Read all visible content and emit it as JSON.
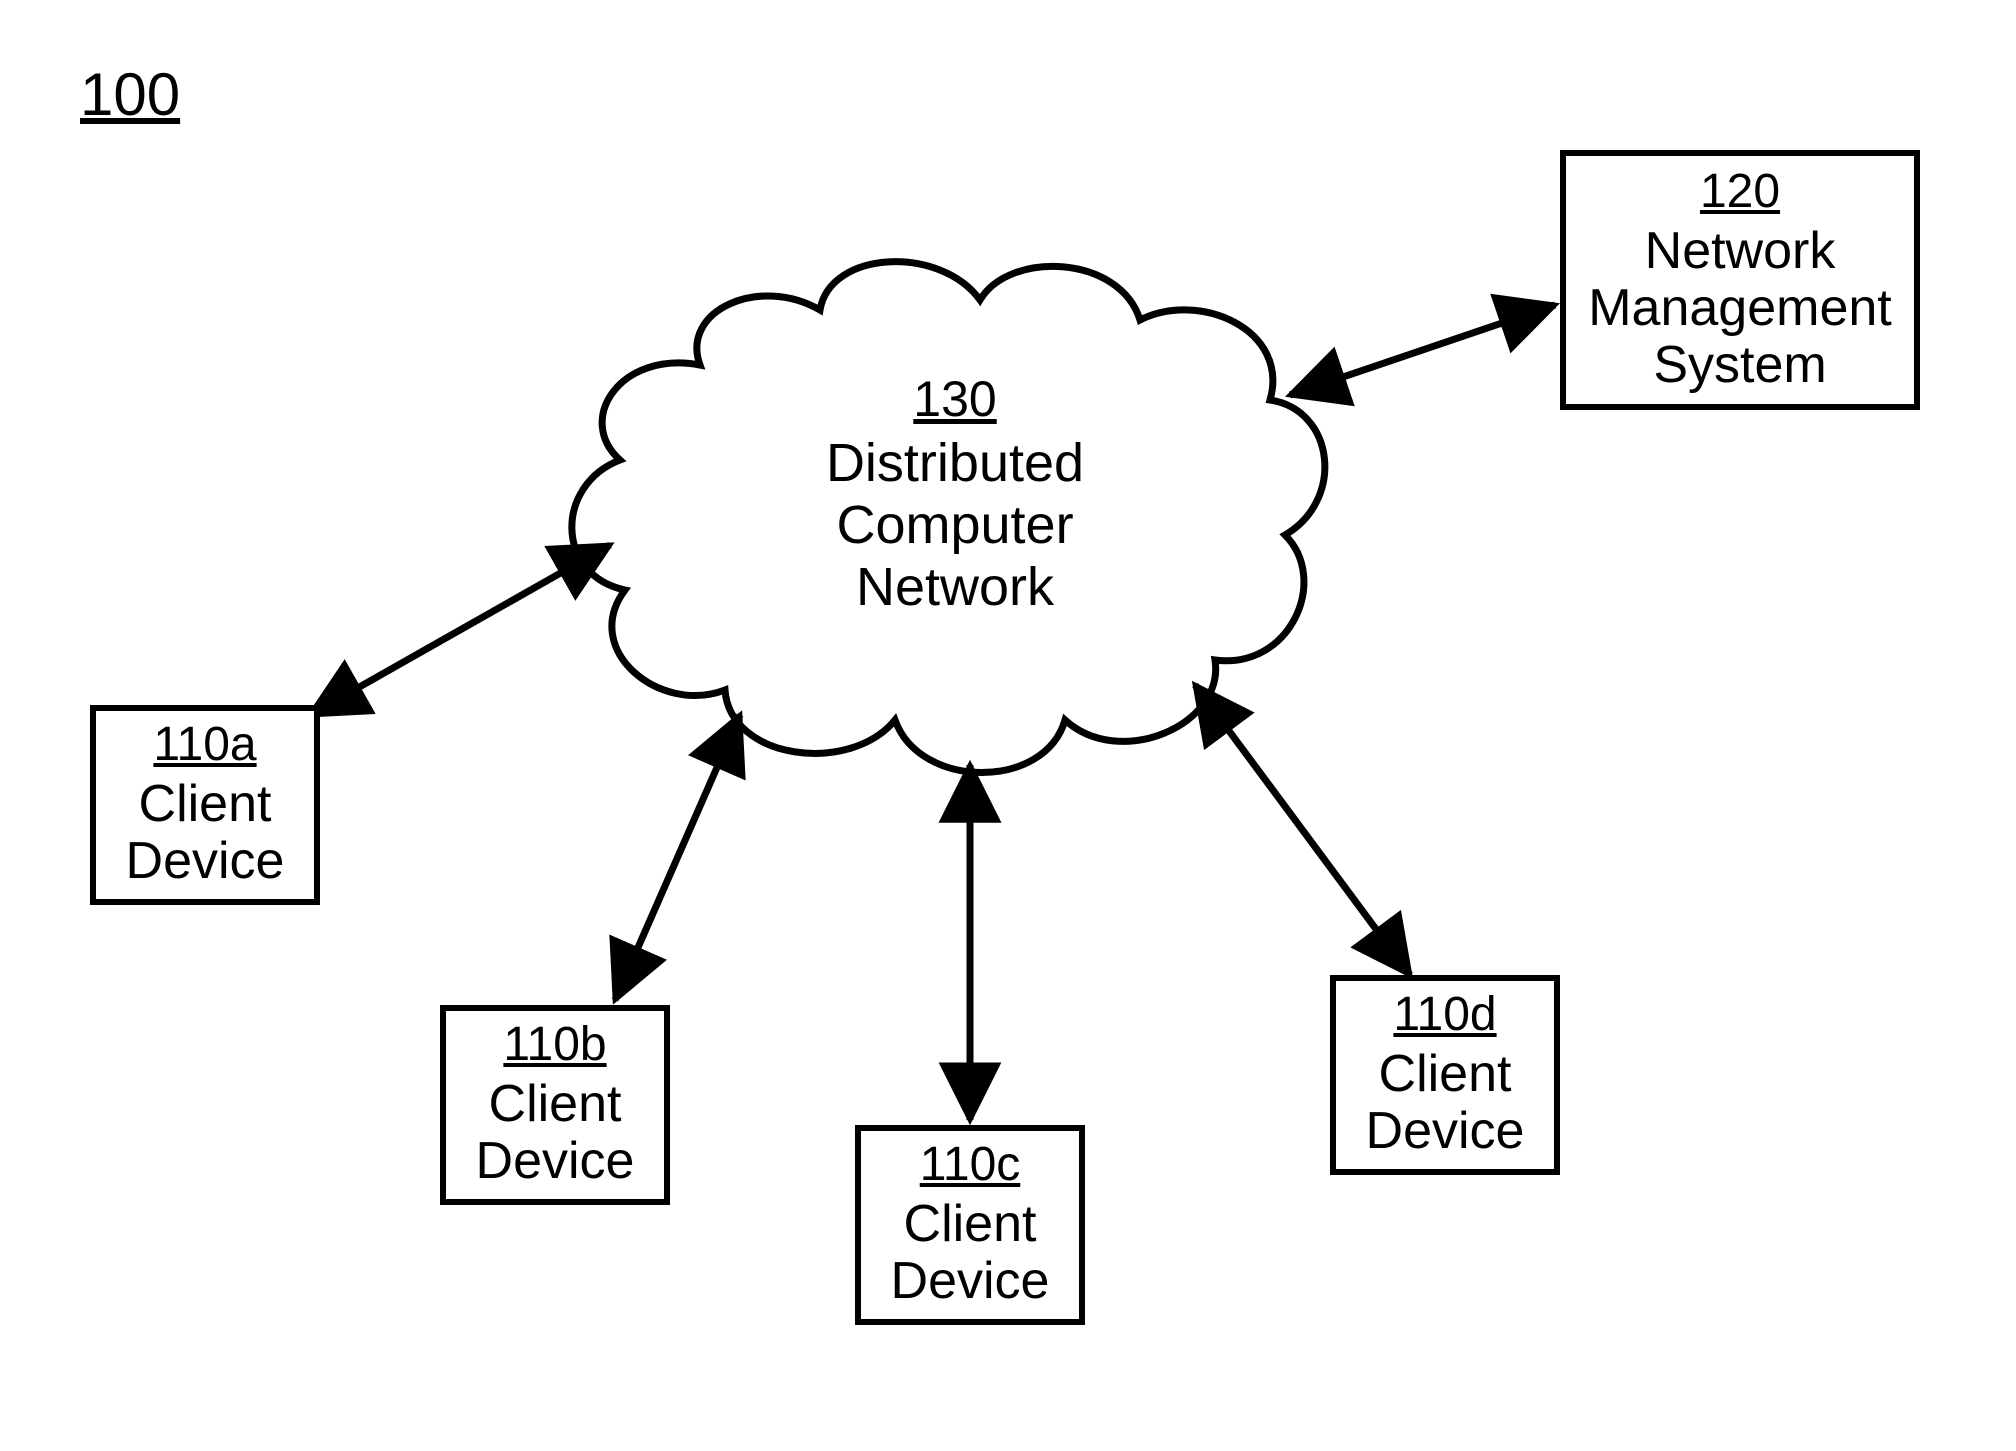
{
  "figure_ref": "100",
  "cloud": {
    "ref": "130",
    "line1": "Distributed",
    "line2": "Computer",
    "line3": "Network"
  },
  "nms": {
    "ref": "120",
    "line1": "Network",
    "line2": "Management",
    "line3": "System"
  },
  "client_a": {
    "ref": "110a",
    "line1": "Client",
    "line2": "Device"
  },
  "client_b": {
    "ref": "110b",
    "line1": "Client",
    "line2": "Device"
  },
  "client_c": {
    "ref": "110c",
    "line1": "Client",
    "line2": "Device"
  },
  "client_d": {
    "ref": "110d",
    "line1": "Client",
    "line2": "Device"
  }
}
